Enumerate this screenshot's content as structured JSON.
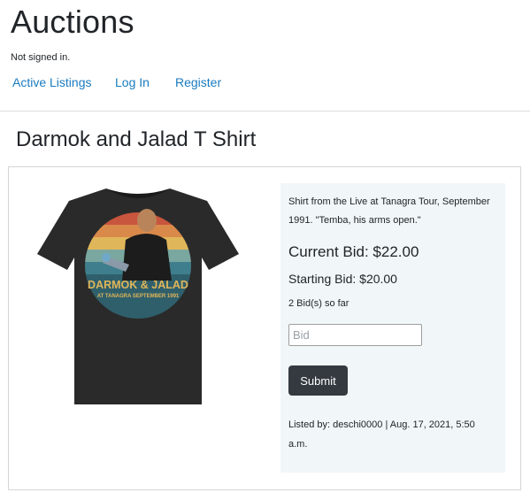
{
  "header": {
    "site_title": "Auctions",
    "signin_status": "Not signed in."
  },
  "nav": {
    "items": [
      {
        "label": "Active Listings"
      },
      {
        "label": "Log In"
      },
      {
        "label": "Register"
      }
    ],
    "link_color": "#1a7bbf"
  },
  "listing": {
    "title": "Darmok and Jalad T Shirt",
    "image": {
      "alt": "Black t-shirt with retro sunset graphic",
      "graphic_title": "DARMOK & JALAD",
      "graphic_subtitle": "AT TANAGRA SEPTEMBER 1991",
      "shirt_color": "#2a2a2a",
      "stripe_colors": [
        "#c8553d",
        "#d98a4b",
        "#e0b65a",
        "#7aa7a0",
        "#3f7e8c"
      ]
    },
    "description": "Shirt from the Live at Tanagra Tour, September 1991. \"Temba, his arms open.\"",
    "current_bid": "Current Bid: $22.00",
    "starting_bid": "Starting Bid: $20.00",
    "bid_count": "2 Bid(s) so far",
    "bid_form": {
      "placeholder": "Bid",
      "value": "",
      "submit_label": "Submit"
    },
    "listed_by": "Listed by: deschi0000 | Aug. 17, 2021, 5:50 a.m.",
    "panel_color": "#f1f6f8",
    "button_color": "#343a40"
  }
}
